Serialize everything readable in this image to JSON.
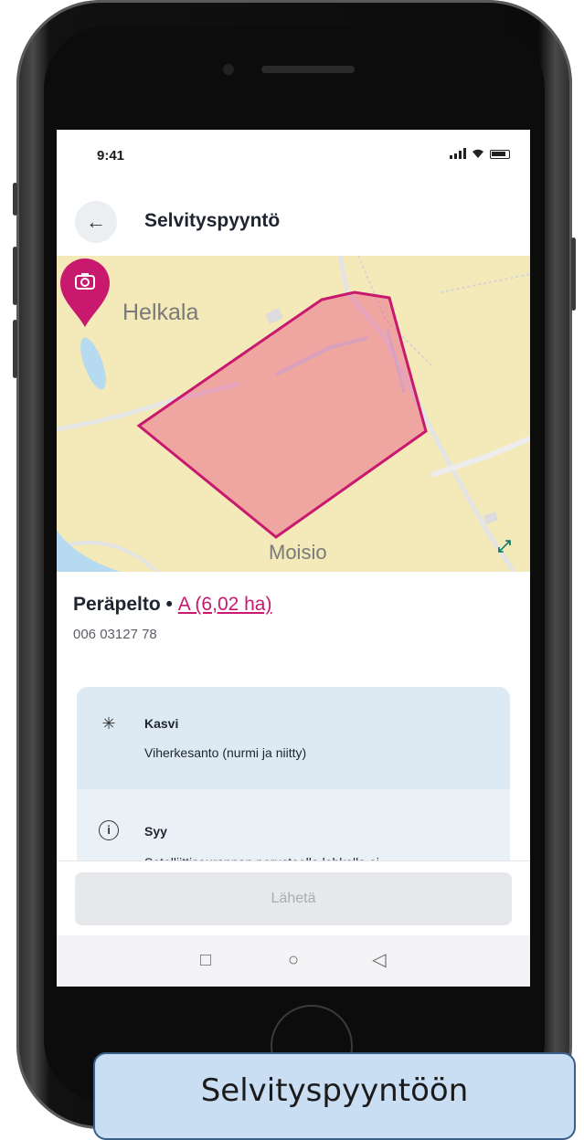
{
  "status_bar": {
    "time": "9:41"
  },
  "header": {
    "title": "Selvityspyyntö"
  },
  "map": {
    "labels": {
      "north": "Helkala",
      "south": "Moisio"
    },
    "parcel_color": "#e8417f",
    "pin_color": "#c8196e",
    "base_color": "#f4e9b8"
  },
  "parcel": {
    "name": "Peräpelto",
    "separator": "•",
    "area_link": "A (6,02 ha)",
    "id": "006 03127 78"
  },
  "details": {
    "crop_label": "Kasvi",
    "crop_value": "Viherkesanto (nurmi ja niitty)",
    "reason_label": "Syy",
    "reason_value": "Satelliittiseurannan perusteella lohkolla ei"
  },
  "footer": {
    "send_label": "Lähetä"
  },
  "caption": {
    "text": "Selvityspyyntöön"
  }
}
